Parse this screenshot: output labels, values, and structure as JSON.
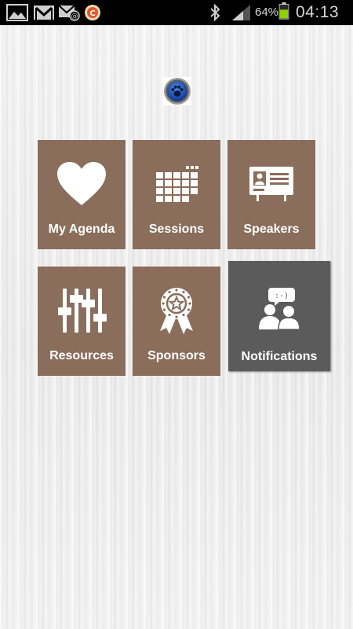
{
  "status_bar": {
    "battery_percent": "64%",
    "time": "04:13",
    "icons": [
      "gallery-icon",
      "gmail-icon",
      "email-icon",
      "app-notification-icon",
      "bluetooth-icon",
      "signal-icon",
      "battery-icon"
    ]
  },
  "app": {
    "logo_icon": "paw-logo-icon"
  },
  "tiles": [
    {
      "label": "My Agenda",
      "icon": "heart-icon"
    },
    {
      "label": "Sessions",
      "icon": "calendar-icon"
    },
    {
      "label": "Speakers",
      "icon": "id-card-icon"
    },
    {
      "label": "Resources",
      "icon": "sliders-icon"
    },
    {
      "label": "Sponsors",
      "icon": "award-ribbon-icon"
    },
    {
      "label": "Notifications",
      "icon": "chat-people-icon",
      "selected": true
    }
  ],
  "colors": {
    "tile": "#8a6d5a",
    "tile_selected": "#5b5b5b",
    "status_bar": "#000000",
    "battery_fill": "#8bd400"
  }
}
